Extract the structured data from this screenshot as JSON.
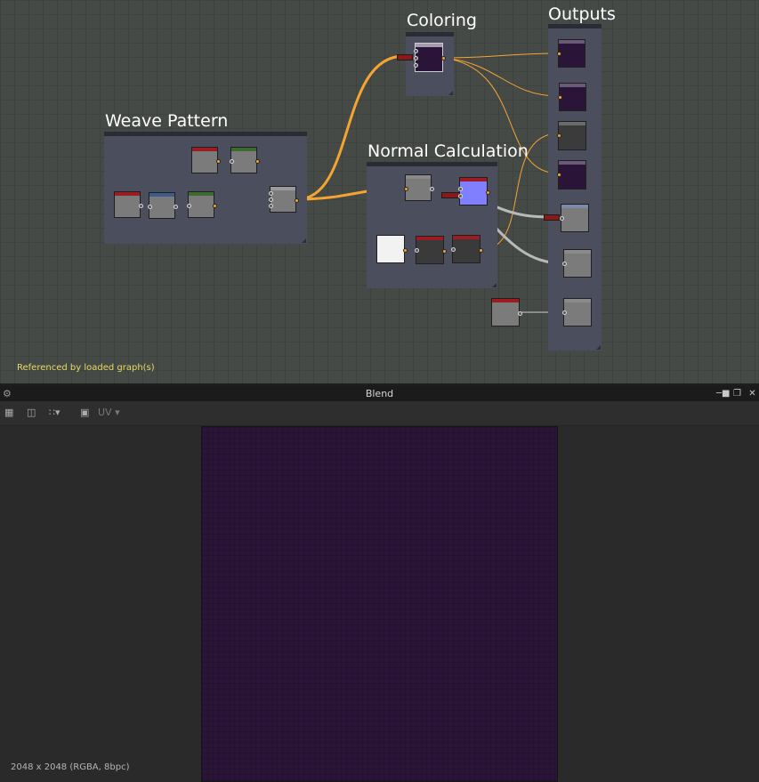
{
  "graph": {
    "frames": [
      {
        "id": "weave",
        "title": "Weave Pattern"
      },
      {
        "id": "coloring",
        "title": "Coloring"
      },
      {
        "id": "normal",
        "title": "Normal Calculation"
      },
      {
        "id": "outputs",
        "title": "Outputs"
      }
    ],
    "note": "Referenced by loaded graph(s)"
  },
  "panel": {
    "title": "Blend",
    "toolbar": {
      "uv_label": "UV"
    },
    "resolution_info": "2048 x 2048 (RGBA, 8bpc)"
  },
  "colors": {
    "wire_orange": "#f4a531",
    "wire_gray": "#b9b9b9",
    "texture": "#2a1438",
    "header_red": "#9c1c22",
    "header_green": "#3d6b2f",
    "header_blue": "#3d5c8c",
    "header_purple": "#6a5a7a"
  },
  "icons": [
    "node-icon",
    "pin-icon",
    "restore-icon",
    "close-icon",
    "channels-icon",
    "save-icon",
    "layout-icon",
    "camera-icon"
  ]
}
